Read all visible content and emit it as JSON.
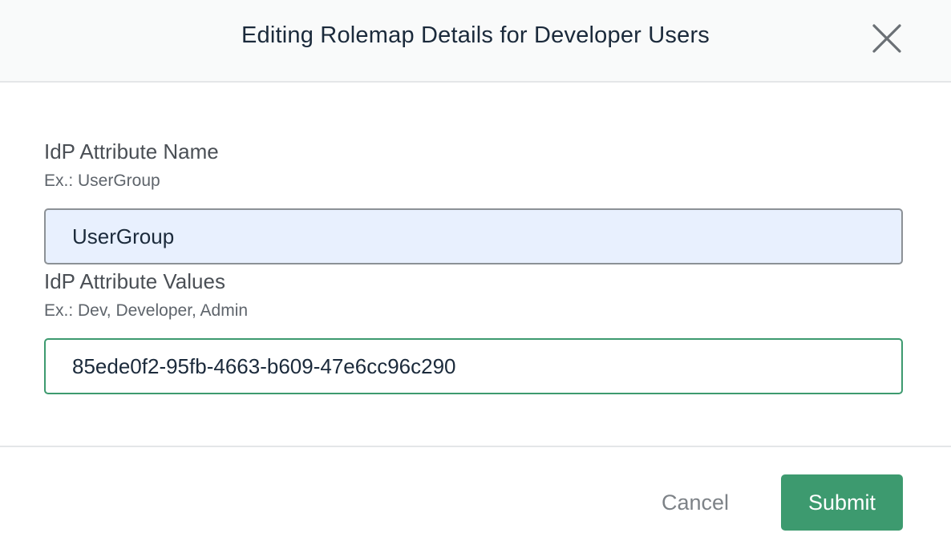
{
  "modal": {
    "title": "Editing Rolemap Details for Developer Users",
    "close_icon": "close-icon"
  },
  "form": {
    "attribute_name": {
      "label": "IdP Attribute Name",
      "hint": "Ex.: UserGroup",
      "value": "UserGroup"
    },
    "attribute_values": {
      "label": "IdP Attribute Values",
      "hint": "Ex.: Dev, Developer, Admin",
      "value": "85ede0f2-95fb-4663-b609-47e6cc96c290"
    }
  },
  "footer": {
    "cancel_label": "Cancel",
    "submit_label": "Submit"
  },
  "colors": {
    "header_background": "#f9fafa",
    "title_text": "#1b2a3b",
    "autofill_background": "#e8f0fe",
    "accent_green": "#3d9a6f",
    "cancel_text": "#7d8287"
  }
}
